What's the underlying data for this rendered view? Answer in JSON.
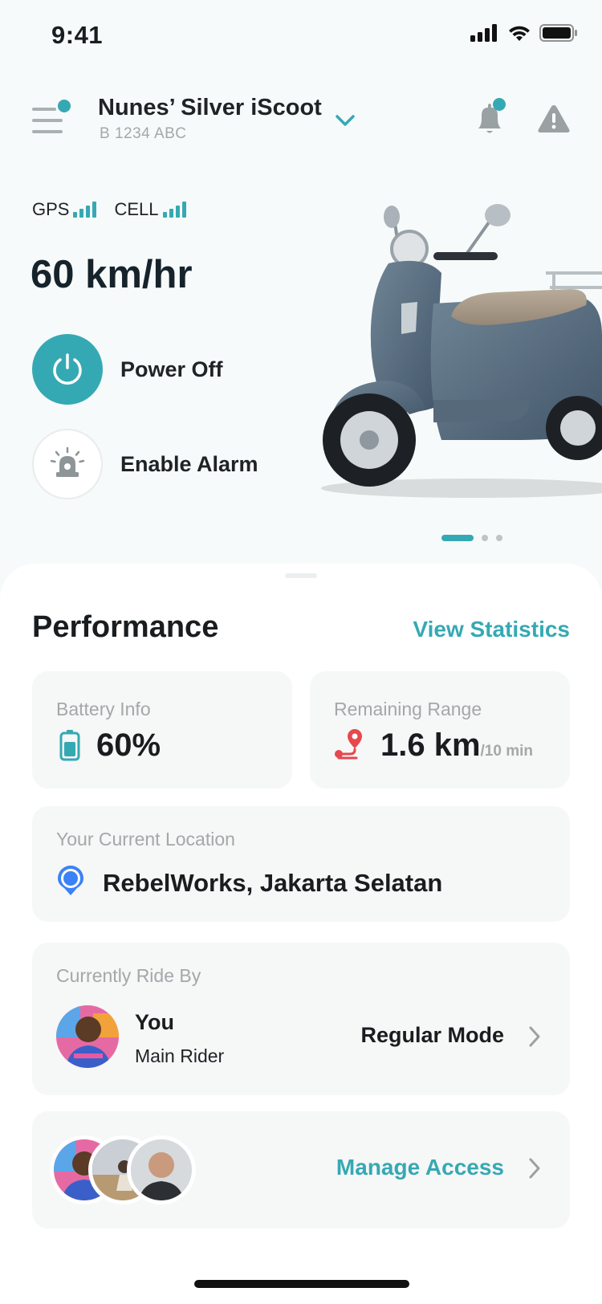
{
  "status_bar": {
    "time": "9:41"
  },
  "header": {
    "vehicle_name": "Nunes’ Silver iScoot",
    "plate": "B 1234 ABC"
  },
  "signals": {
    "gps_label": "GPS",
    "cell_label": "CELL"
  },
  "speed": "60 km/hr",
  "actions": {
    "power_label": "Power Off",
    "alarm_label": "Enable Alarm"
  },
  "carousel": {
    "total": 3,
    "active": 1
  },
  "performance": {
    "title": "Performance",
    "view_stats": "View Statistics",
    "battery": {
      "label": "Battery Info",
      "value": "60%"
    },
    "range": {
      "label": "Remaining Range",
      "value": "1.6 km",
      "unit": "/10 min"
    },
    "location": {
      "label": "Your Current Location",
      "value": "RebelWorks, Jakarta Selatan"
    },
    "rider": {
      "label": "Currently Ride By",
      "name": "You",
      "role": "Main Rider",
      "mode": "Regular Mode"
    },
    "access": {
      "label": "Manage Access"
    }
  },
  "colors": {
    "accent": "#35a9b3",
    "range_icon": "#e5484d",
    "location_icon": "#3b82f6",
    "text_dark": "#1a1d1f",
    "text_muted": "#a3a8aa"
  }
}
